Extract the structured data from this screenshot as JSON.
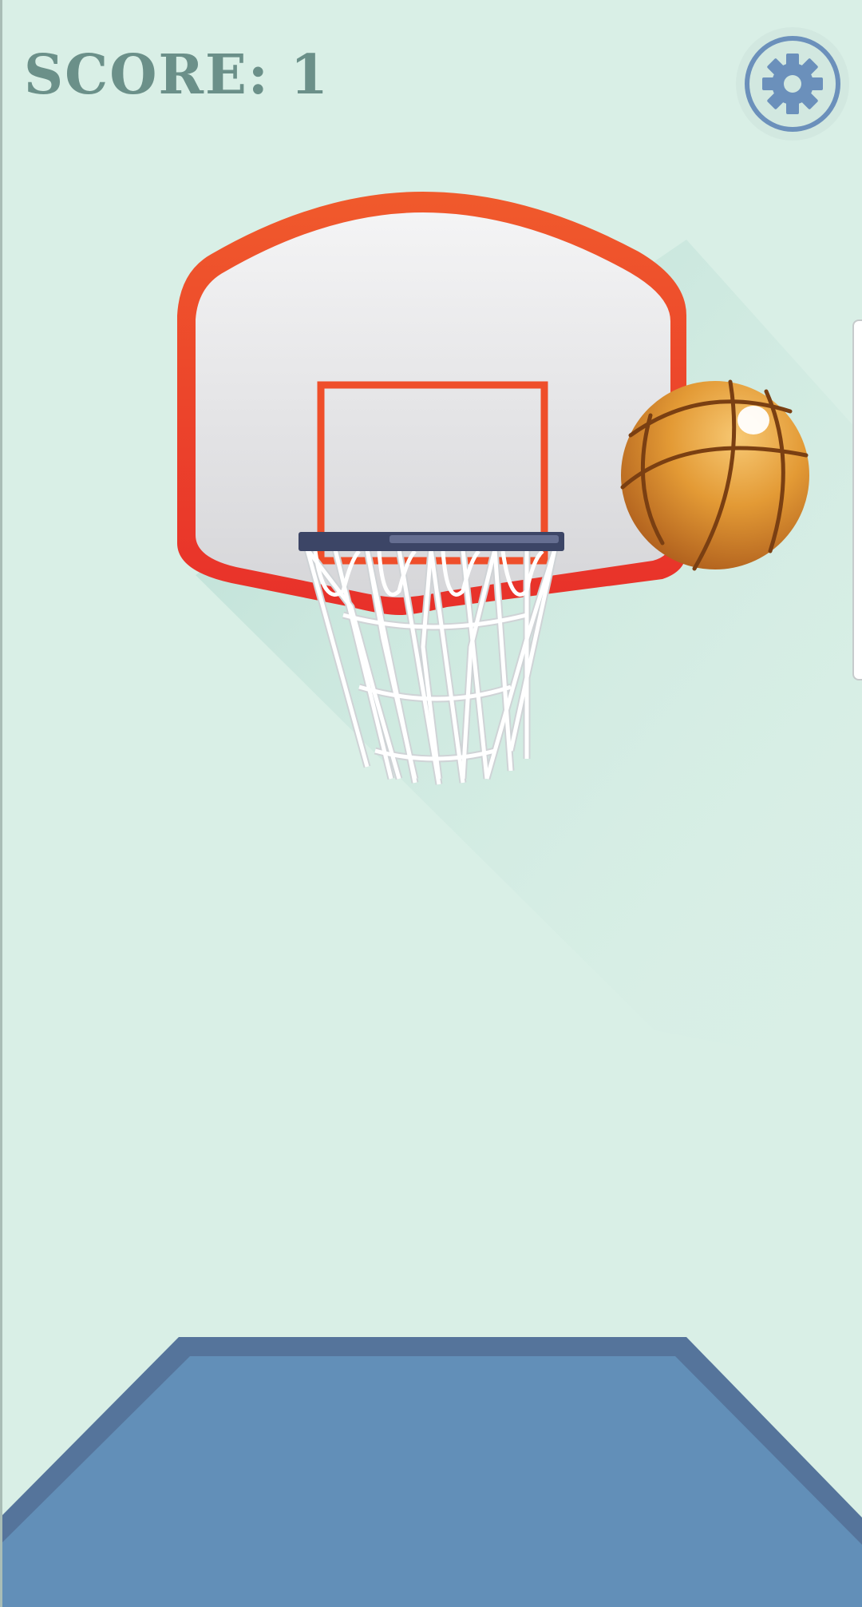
{
  "hud": {
    "score_label": "SCORE: 1",
    "settings_icon": "gear-icon"
  },
  "colors": {
    "background": "#d9efe6",
    "score_text": "#6b9089",
    "gear": "#6b90bb",
    "backboard_frame": "#ef4e2a",
    "rim": "#3c4566",
    "net": "#ffffff",
    "ball": "#e08f2e",
    "court": "#628fb8",
    "court_border": "#55749b"
  }
}
